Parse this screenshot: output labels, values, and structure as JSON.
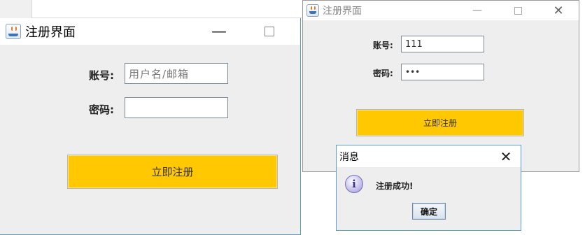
{
  "register_window_main": {
    "title": "注册界面",
    "minimize_glyph": "—",
    "account_label": "账号:",
    "account_placeholder": "用户名/邮箱",
    "account_value": "",
    "password_label": "密码:",
    "password_value": "",
    "register_button_label": "立即注册",
    "button_color": "#ffc800"
  },
  "register_window_back": {
    "title": "注册界面",
    "minimize_glyph": "—",
    "close_glyph": "✕",
    "account_label": "账号:",
    "account_value": "111",
    "password_label": "密码:",
    "password_masked": "•••",
    "register_button_label": "立即注册"
  },
  "message_dialog": {
    "title": "消息",
    "close_glyph": "✕",
    "icon": "info-icon",
    "icon_glyph": "i",
    "message": "注册成功!",
    "ok_button_label": "确定"
  },
  "colors": {
    "accent_border": "#5a9bd5",
    "window_body": "#eeeeee"
  }
}
